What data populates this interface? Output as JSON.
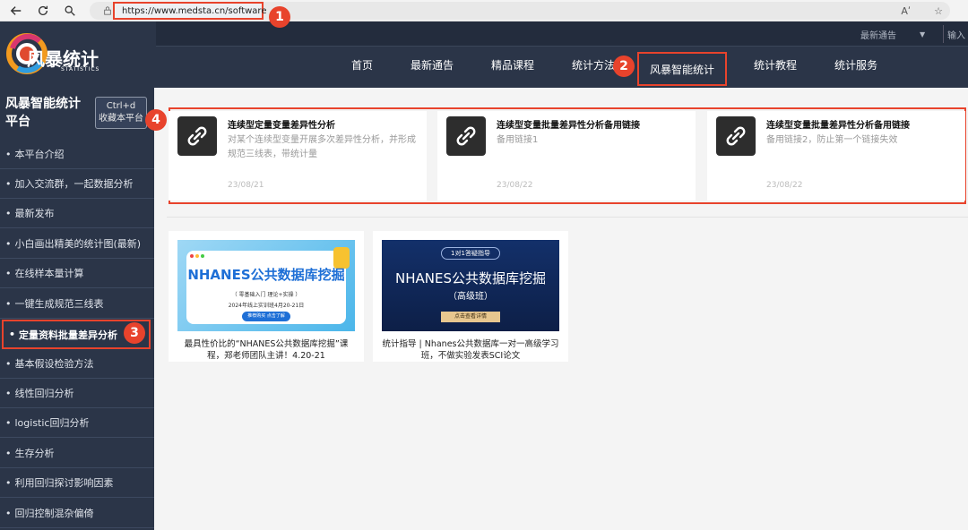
{
  "browser": {
    "url": "https://www.medsta.cn/software",
    "reader_icon": "Aʹ",
    "icons": [
      "back-icon",
      "refresh-icon",
      "search-icon",
      "lock-icon",
      "read-aloud-icon",
      "favorite-icon"
    ]
  },
  "site": {
    "logo_text": "风暴统计",
    "logo_sub": "STATISTICS",
    "topbar": {
      "select_label": "最新通告",
      "select_arrow": "▼",
      "input_label": "输入"
    },
    "nav": [
      "首页",
      "最新通告",
      "精品课程",
      "统计方法"
    ],
    "nav_active": "风暴智能统计",
    "nav_rest": [
      "统计教程",
      "统计服务"
    ]
  },
  "sidebar": {
    "title": "风暴智能统计平台",
    "bookmark_key": "Ctrl+d",
    "bookmark_label": "收藏本平台",
    "items": [
      "本平台介绍",
      "加入交流群，一起数据分析",
      "最新发布",
      "小白画出精美的统计图(最新)",
      "在线样本量计算",
      "一键生成规范三线表",
      "定量资料批量差异分析",
      "基本假设检验方法",
      "线性回归分析",
      "logistic回归分析",
      "生存分析",
      "利用回归探讨影响因素",
      "回归控制混杂偏倚"
    ],
    "active_index": 6
  },
  "cards": [
    {
      "title": "连续型定量变量差异性分析",
      "desc": "对某个连续型变量开展多次差异性分析，并形成规范三线表，带统计量",
      "date": "23/08/21"
    },
    {
      "title": "连续型变量批量差异性分析备用链接",
      "desc": "备用链接1",
      "date": "23/08/22"
    },
    {
      "title": "连续型变量批量差异性分析备用链接",
      "desc": "备用链接2，防止第一个链接失效",
      "date": "23/08/22"
    }
  ],
  "promos": [
    {
      "banner_title": "NHANES公共数据库挖掘",
      "banner_sub": "（ 零基础入门  理论+实操 ）",
      "banner_date": "2024年线上实训班4月20-21日",
      "banner_btn": "推荐购买 点击了解",
      "caption": "最具性价比的“NHANES公共数据库挖掘”课程，郑老师团队主讲！4.20-21"
    },
    {
      "banner_tag": "1对1答疑指导",
      "banner_title": "NHANES公共数据库挖掘",
      "banner_sub": "（高级班）",
      "banner_btn": "点击查看详情",
      "caption": "统计指导 | Nhanes公共数据库一对一高级学习班，不做实验发表SCI论文"
    }
  ],
  "annotations": [
    "1",
    "2",
    "3",
    "4"
  ],
  "colors": {
    "header": "#2b3548",
    "highlight": "#e8432c",
    "content_bg": "#f4f4f4"
  }
}
